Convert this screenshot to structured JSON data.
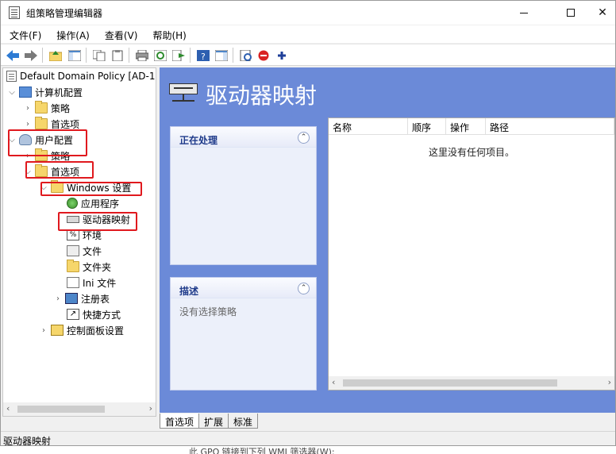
{
  "window": {
    "title": "组策略管理编辑器",
    "controls": {
      "minimize": "",
      "maximize": "",
      "close": "✕"
    }
  },
  "menu": [
    "文件(F)",
    "操作(A)",
    "查看(V)",
    "帮助(H)"
  ],
  "toolbar_icons": [
    "back-icon",
    "forward-icon",
    "up-folder-icon",
    "show-hide-tree-icon",
    "copy-icon",
    "paste-icon",
    "print-icon",
    "refresh-icon",
    "export-icon",
    "help-icon",
    "show-action-pane-icon",
    "properties-icon",
    "stop-icon",
    "add-icon"
  ],
  "tree": {
    "root": "Default Domain Policy [AD-1.",
    "computer_config": "计算机配置",
    "policies_1": "策略",
    "preferences_1": "首选项",
    "user_config": "用户配置",
    "policies_2": "策略",
    "preferences_2": "首选项",
    "windows_settings": "Windows 设置",
    "applications": "应用程序",
    "drive_maps": "驱动器映射",
    "environment": "环境",
    "files": "文件",
    "folders": "文件夹",
    "ini_files": "Ini 文件",
    "registry": "注册表",
    "shortcuts": "快捷方式",
    "control_panel": "控制面板设置"
  },
  "content": {
    "title": "驱动器映射",
    "processing_panel": {
      "title": "正在处理"
    },
    "description_panel": {
      "title": "描述",
      "body": "没有选择策略"
    },
    "list": {
      "columns": [
        "名称",
        "顺序",
        "操作",
        "路径"
      ],
      "empty_message": "这里没有任何项目。"
    }
  },
  "tabs": [
    "首选项",
    "扩展",
    "标准"
  ],
  "status": "驱动器映射",
  "background_text": "此 GPO 链接到下列 WMI 筛选器(W):",
  "colors": {
    "content_background": "#6b8ad8",
    "highlight_box": "#e0191e",
    "panel_title": "#1e3a8a"
  }
}
